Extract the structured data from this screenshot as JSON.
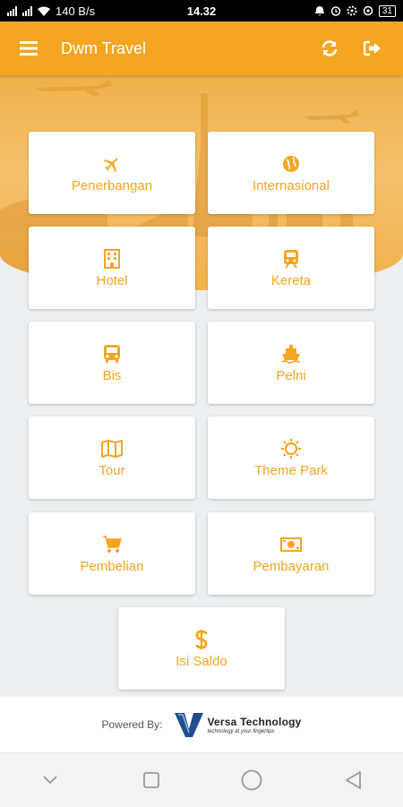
{
  "status_bar": {
    "network_speed": "140 B/s",
    "time": "14.32",
    "battery": "31"
  },
  "app_bar": {
    "title": "Dwm Travel",
    "menu_icon": "menu-icon",
    "refresh_icon": "refresh-icon",
    "logout_icon": "logout-icon"
  },
  "menu": {
    "items": [
      {
        "label": "Penerbangan",
        "icon": "airplane-icon"
      },
      {
        "label": "Internasional",
        "icon": "globe-icon"
      },
      {
        "label": "Hotel",
        "icon": "hotel-icon"
      },
      {
        "label": "Kereta",
        "icon": "train-icon"
      },
      {
        "label": "Bis",
        "icon": "bus-icon"
      },
      {
        "label": "Pelni",
        "icon": "ship-icon"
      },
      {
        "label": "Tour",
        "icon": "map-icon"
      },
      {
        "label": "Theme Park",
        "icon": "sun-icon"
      },
      {
        "label": "Pembelian",
        "icon": "cart-icon"
      },
      {
        "label": "Pembayaran",
        "icon": "money-icon"
      },
      {
        "label": "Isi Saldo",
        "icon": "dollar-icon"
      }
    ]
  },
  "footer": {
    "powered_by": "Powered By:",
    "brand_name": "Versa Technology",
    "brand_tagline": "technology at your fingertips"
  },
  "colors": {
    "accent": "#f4a622",
    "background": "#eceff1",
    "card": "#ffffff"
  }
}
